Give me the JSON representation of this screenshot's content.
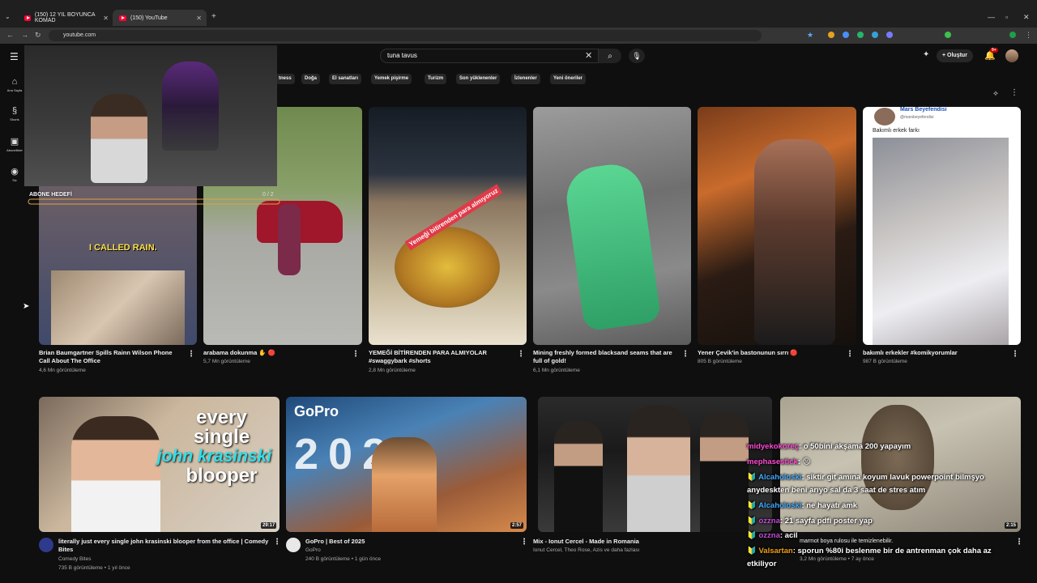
{
  "browser": {
    "tabs": [
      {
        "title": "(150) 12 YIL BOYUNCA KOMAD"
      },
      {
        "title": "(150) YouTube"
      }
    ],
    "address": "youtube.com",
    "new_tab": "+"
  },
  "youtube": {
    "search_query": "tuna tavus",
    "create_label": "Oluştur",
    "notif_count": "9+",
    "sidebar": [
      {
        "label": "Ana Sayfa",
        "icon": "home-icon"
      },
      {
        "label": "Shorts",
        "icon": "shorts-icon"
      },
      {
        "label": "Abonelikler",
        "icon": "subscriptions-icon"
      },
      {
        "label": "Siz",
        "icon": "you-icon"
      }
    ],
    "chips": [
      "tness",
      "Doğa",
      "El sanatları",
      "Yemek pişirme",
      "Turizm",
      "Son yüklenenler",
      "İzlenenler",
      "Yeni öneriler"
    ]
  },
  "shorts": [
    {
      "title": "Brian Baumgartner Spills Rainn Wilson Phone Call About The Office",
      "views": "4,6 Mn görüntüleme",
      "overlay": "I CALLED RAIN."
    },
    {
      "title": "arabama dokunma ✋ 🔴",
      "views": "5,7 Mn görüntüleme"
    },
    {
      "title": "YEMEĞİ BİTİRENDEN PARA ALMIYOLAR #swaggybark #shorts",
      "views": "2,8 Mn görüntüleme",
      "overlay": "Yemeği bitirenden para almıyoruz"
    },
    {
      "title": "Mining freshly formed blacksand seams that are full of gold!",
      "views": "6,1 Mn görüntüleme"
    },
    {
      "title": "Yener Çevik'in bastonunun sırrı 🔴",
      "views": "805 B görüntüleme"
    },
    {
      "title": "bakımlı erkekler #komikyorumlar",
      "views": "987 B görüntüleme",
      "tweet_name": "Mars Beyefendisi",
      "tweet_handle": "@marsbeyefendisi",
      "tweet_text": "Bakımlı erkek farkı"
    }
  ],
  "videos": [
    {
      "title": "literally just every single john krasinski blooper from the office | Comedy Bites",
      "channel": "Comedy Bites",
      "meta": "735 B görüntüleme • 1 yıl önce",
      "duration": "29:17",
      "thumb_text": [
        "every",
        "single",
        "john krasinski",
        "blooper"
      ]
    },
    {
      "title": "GoPro | Best of 2025",
      "channel": "GoPro",
      "meta": "240 B görüntüleme • 1 gün önce",
      "duration": "2:57",
      "thumb_text": [
        "GoPro",
        "2025"
      ]
    },
    {
      "title": "Mix - Ionut Cercel - Made in Romania",
      "channel": "Ionut Cercel, Theo Rose, Azis ve daha fazlası",
      "meta": ""
    },
    {
      "title": "marmot boya rulosu ile temizlenebilir.",
      "channel": "",
      "meta": "3,2 Mn görüntüleme • 7 ay önce",
      "duration": "2:15"
    }
  ],
  "stream_overlay": {
    "goal_text": "ABONE HEDEFİ",
    "goal_count": "0 / 2"
  },
  "chat": [
    {
      "user": "midyekokoreç",
      "msg": ": o 50bini akşama 200 yapayım"
    },
    {
      "user": "mephasestick",
      "msg": ": 😐"
    },
    {
      "user": "Alcaholoski",
      "msg": ": siktir git amına koyum lavuk powerpoint bilmşyo"
    },
    {
      "user": "",
      "msg": "anydeskten beni arıyo sal da 3 saat de stres atım"
    },
    {
      "user": "Alcaholoski",
      "msg": ": ne hayatı amk"
    },
    {
      "user": "ozzna",
      "msg": ": 21 sayfa pdfi poster yap"
    },
    {
      "user": "ozzna",
      "msg": ": acil"
    },
    {
      "user": "Valsartan",
      "msg": ": sporun %80i beslenme bir de antrenman çok daha az"
    },
    {
      "user": "",
      "msg": "etkiliyor"
    }
  ],
  "colors": {
    "bg": "#0f0f0f",
    "brand": "#ff0033",
    "chip": "#272727"
  }
}
